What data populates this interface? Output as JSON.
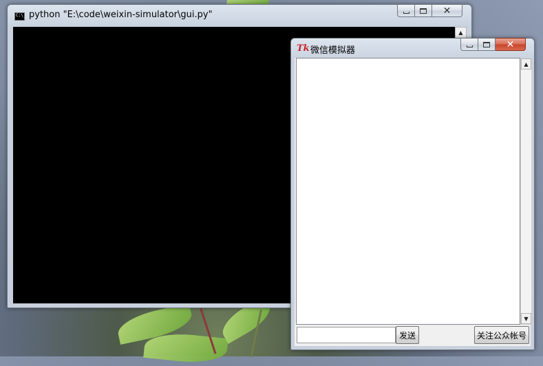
{
  "console_window": {
    "title": "python  \"E:\\code\\weixin-simulator\\gui.py\"",
    "icon_text": "C:\\_"
  },
  "tk_window": {
    "icon_text": "Tk",
    "title": "微信模拟器",
    "message_input": {
      "value": "",
      "placeholder": ""
    },
    "send_button_label": "发送",
    "follow_button_label": "关注公众帐号"
  },
  "window_controls": {
    "minimize": "minimize",
    "maximize": "maximize",
    "close": "close"
  },
  "colors": {
    "console_background": "#000000",
    "chat_background": "#ffffff",
    "close_button": "#c7432b",
    "tk_logo": "#c8242b"
  }
}
